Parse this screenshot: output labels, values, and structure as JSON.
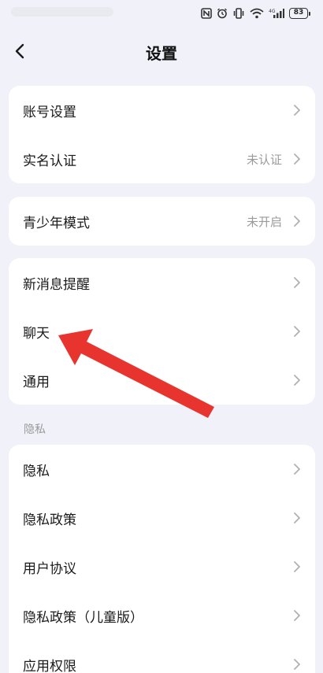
{
  "status_bar": {
    "battery_level": "83"
  },
  "header": {
    "title": "设置"
  },
  "group1": [
    {
      "label": "账号设置",
      "value": ""
    },
    {
      "label": "实名认证",
      "value": "未认证"
    }
  ],
  "group2": [
    {
      "label": "青少年模式",
      "value": "未开启"
    }
  ],
  "group3": [
    {
      "label": "新消息提醒"
    },
    {
      "label": "聊天"
    },
    {
      "label": "通用"
    }
  ],
  "privacy_section": {
    "header": "隐私",
    "items": [
      {
        "label": "隐私"
      },
      {
        "label": "隐私政策"
      },
      {
        "label": "用户协议"
      },
      {
        "label": "隐私政策（儿童版）"
      },
      {
        "label": "应用权限"
      }
    ]
  },
  "colors": {
    "background": "#f1f2f9",
    "card": "#ffffff",
    "annotation_arrow": "#e8342e",
    "secondary_text": "#9a9a9a"
  }
}
